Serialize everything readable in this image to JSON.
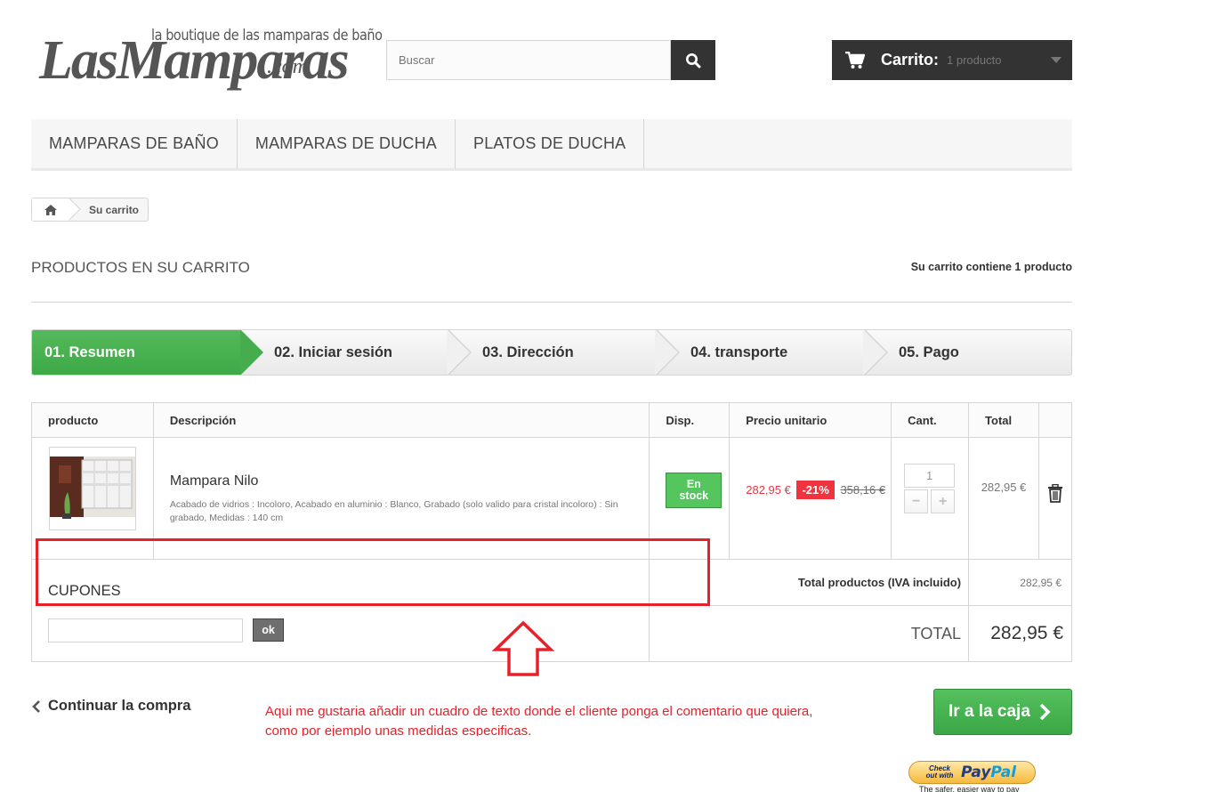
{
  "header": {
    "logo_tagline": "la boutique de las mamparas de baño",
    "logo_main": "LasMamparas",
    "logo_suffix": ".com",
    "search": {
      "placeholder": "Buscar"
    },
    "cart": {
      "label": "Carrito:",
      "count": "1 producto"
    }
  },
  "menu": [
    {
      "label": "MAMPARAS DE BAÑO"
    },
    {
      "label": "MAMPARAS DE DUCHA"
    },
    {
      "label": "PLATOS DE DUCHA"
    }
  ],
  "breadcrumb": {
    "current": "Su carrito"
  },
  "page": {
    "title": "PRODUCTOS EN SU CARRITO",
    "cart_summary": "Su carrito contiene 1 producto"
  },
  "steps": [
    {
      "label": "01. Resumen"
    },
    {
      "label": "02. Iniciar sesión"
    },
    {
      "label": "03. Dirección"
    },
    {
      "label": "04. transporte"
    },
    {
      "label": "05. Pago"
    }
  ],
  "table": {
    "headers": [
      "producto",
      "Descripción",
      "Disp.",
      "Precio unitario",
      "Cant.",
      "Total"
    ],
    "item": {
      "name": "Mampara Nilo",
      "attributes": "Acabado de vidrios : Incoloro, Acabado en aluminio : Blanco, Grabado (solo valido para cristal incoloro) : Sin grabado, Medidas : 140 cm",
      "availability_line1": "En",
      "availability_line2": "stock",
      "price": "282,95 €",
      "discount": "-21%",
      "old_price": "358,16 €",
      "quantity": "1",
      "total": "282,95 €"
    },
    "total_products_label": "Total productos (IVA incluido)",
    "total_products_value": "282,95 €",
    "grand_total_label": "TOTAL",
    "grand_total_value": "282,95 €"
  },
  "coupons": {
    "title": "CUPONES",
    "ok_label": "ok"
  },
  "annotation": {
    "line1": "Aqui me gustaria añadir un cuadro de texto donde el cliente ponga el comentario que quiera,",
    "line2": "como por ejemplo unas medidas especificas."
  },
  "footer": {
    "continue_label": "Continuar la compra",
    "checkout_label": "Ir a la caja",
    "paypal_checkout": "Check out with",
    "paypal_brand_1": "Pay",
    "paypal_brand_2": "Pal",
    "paypal_tagline": "The safer, easier way to pay"
  },
  "colors": {
    "accent_green": "#46a74e",
    "dark": "#333333",
    "sale_red": "#f13340",
    "annotation_red": "#e8202a"
  }
}
